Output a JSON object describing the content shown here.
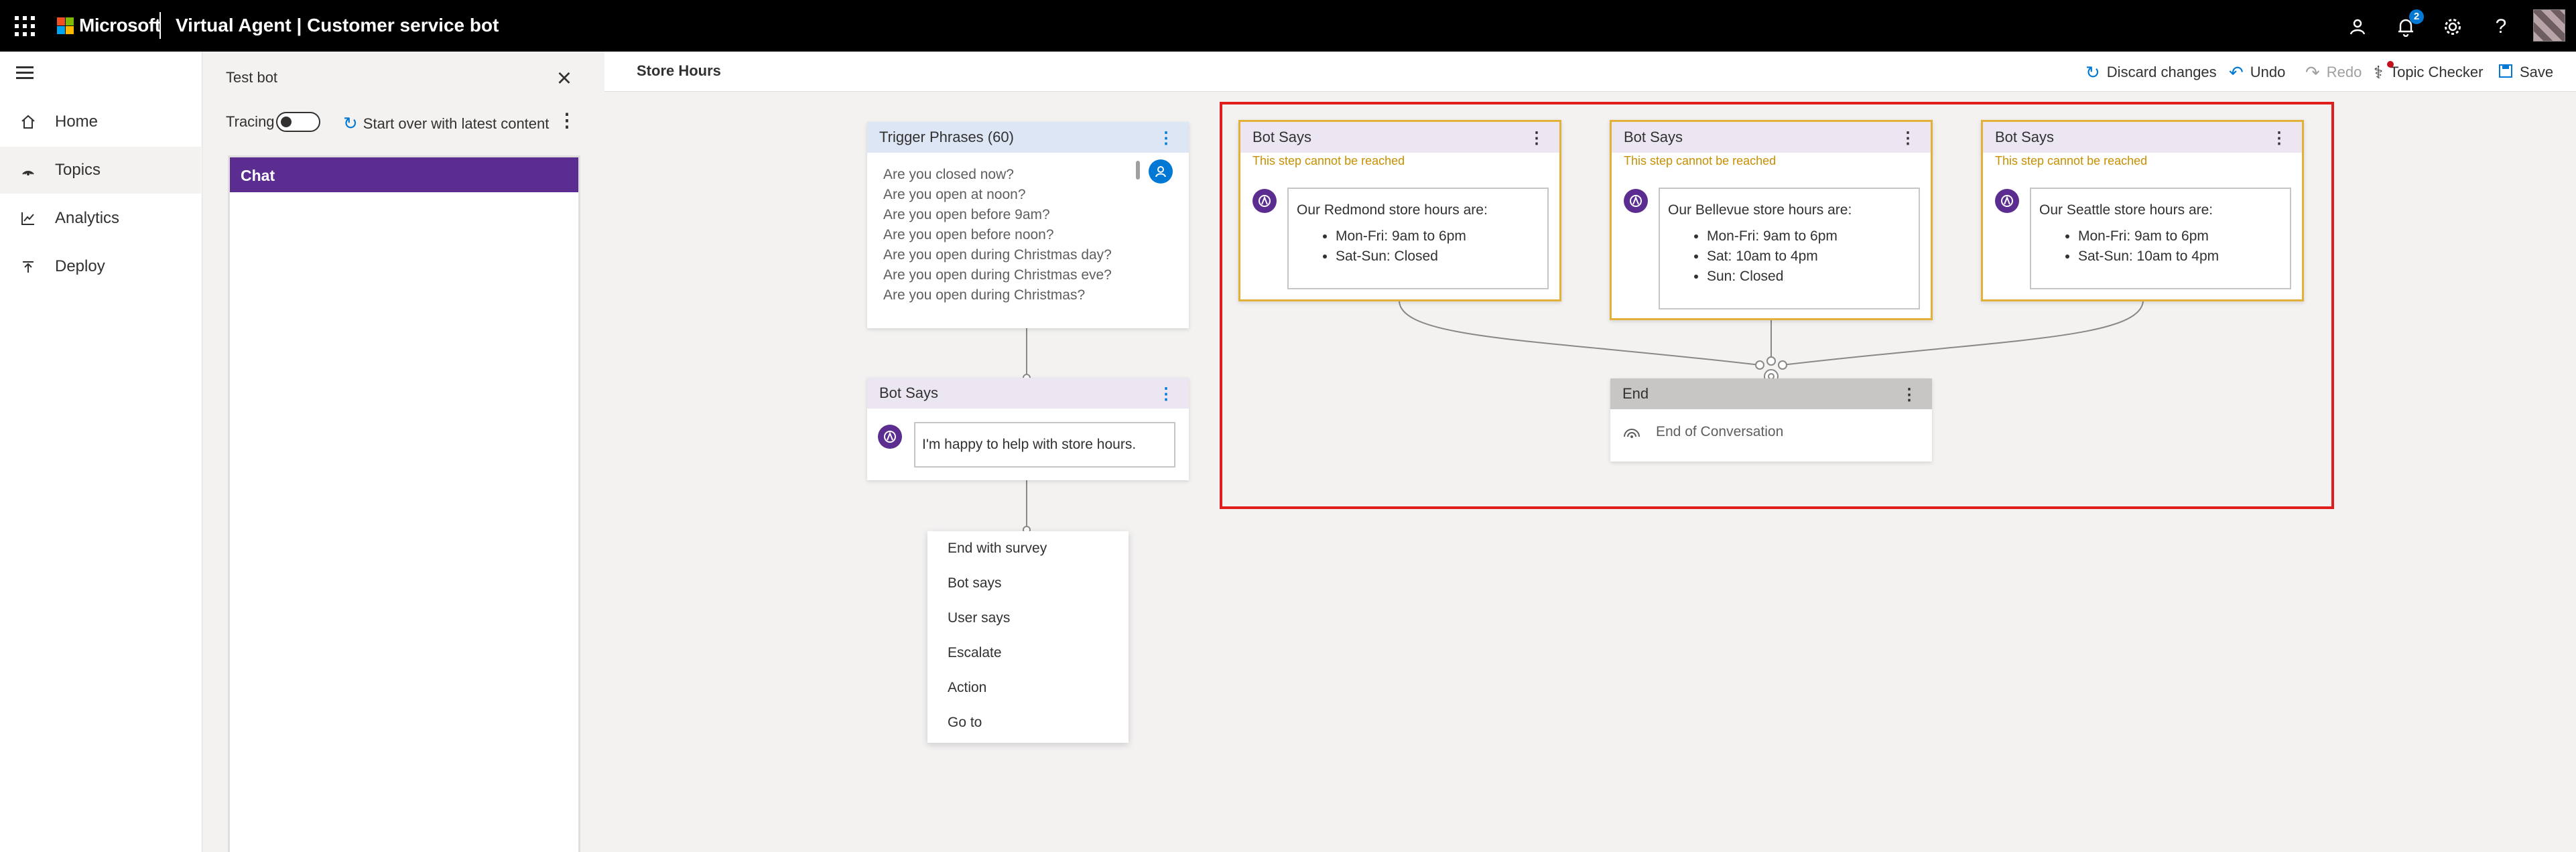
{
  "topbar": {
    "brand": "Microsoft",
    "app_title": "Virtual Agent | Customer service bot",
    "notification_count": "2",
    "brand_colors": [
      "#f25022",
      "#7fba00",
      "#00a4ef",
      "#ffb900"
    ]
  },
  "nav": {
    "items": [
      {
        "label": "Home",
        "icon": "home-icon"
      },
      {
        "label": "Topics",
        "icon": "topics-icon"
      },
      {
        "label": "Analytics",
        "icon": "analytics-icon"
      },
      {
        "label": "Deploy",
        "icon": "deploy-icon"
      }
    ],
    "active": "Topics"
  },
  "testbot": {
    "title": "Test bot",
    "tracing_label": "Tracing",
    "tracing_on": false,
    "start_over_label": "Start over with latest content",
    "chat_header": "Chat"
  },
  "canvas": {
    "page_title": "Store Hours",
    "commands": {
      "discard": "Discard changes",
      "undo": "Undo",
      "redo": "Redo",
      "topic_checker": "Topic Checker",
      "save": "Save"
    }
  },
  "trigger": {
    "title": "Trigger Phrases (60)",
    "phrases": [
      "Are you closed now?",
      "Are you open at noon?",
      "Are you open before 9am?",
      "Are you open before noon?",
      "Are you open during Christmas day?",
      "Are you open during Christmas eve?",
      "Are you open during Christmas?"
    ]
  },
  "bot_main": {
    "title": "Bot Says",
    "message": "I'm happy to help with store hours."
  },
  "add_menu": {
    "items": [
      "End with survey",
      "Bot says",
      "User says",
      "Escalate",
      "Action",
      "Go to"
    ]
  },
  "branches": [
    {
      "title": "Bot Says",
      "warning": "This step cannot be reached",
      "intro": "Our Redmond store hours are:",
      "lines": [
        "Mon-Fri: 9am to 6pm",
        "Sat-Sun: Closed"
      ]
    },
    {
      "title": "Bot Says",
      "warning": "This step cannot be reached",
      "intro": "Our Bellevue store hours are:",
      "lines": [
        "Mon-Fri: 9am to 6pm",
        "Sat: 10am to 4pm",
        "Sun: Closed"
      ]
    },
    {
      "title": "Bot Says",
      "warning": "This step cannot be reached",
      "intro": "Our Seattle store hours are:",
      "lines": [
        "Mon-Fri: 9am to 6pm",
        "Sat-Sun: 10am to 4pm"
      ]
    }
  ],
  "end": {
    "title": "End",
    "label": "End of Conversation"
  },
  "colors": {
    "accent": "#0078d4",
    "bot_purple": "#5c2d91",
    "warning": "#e3b039",
    "highlight_red": "#e01e1e"
  }
}
